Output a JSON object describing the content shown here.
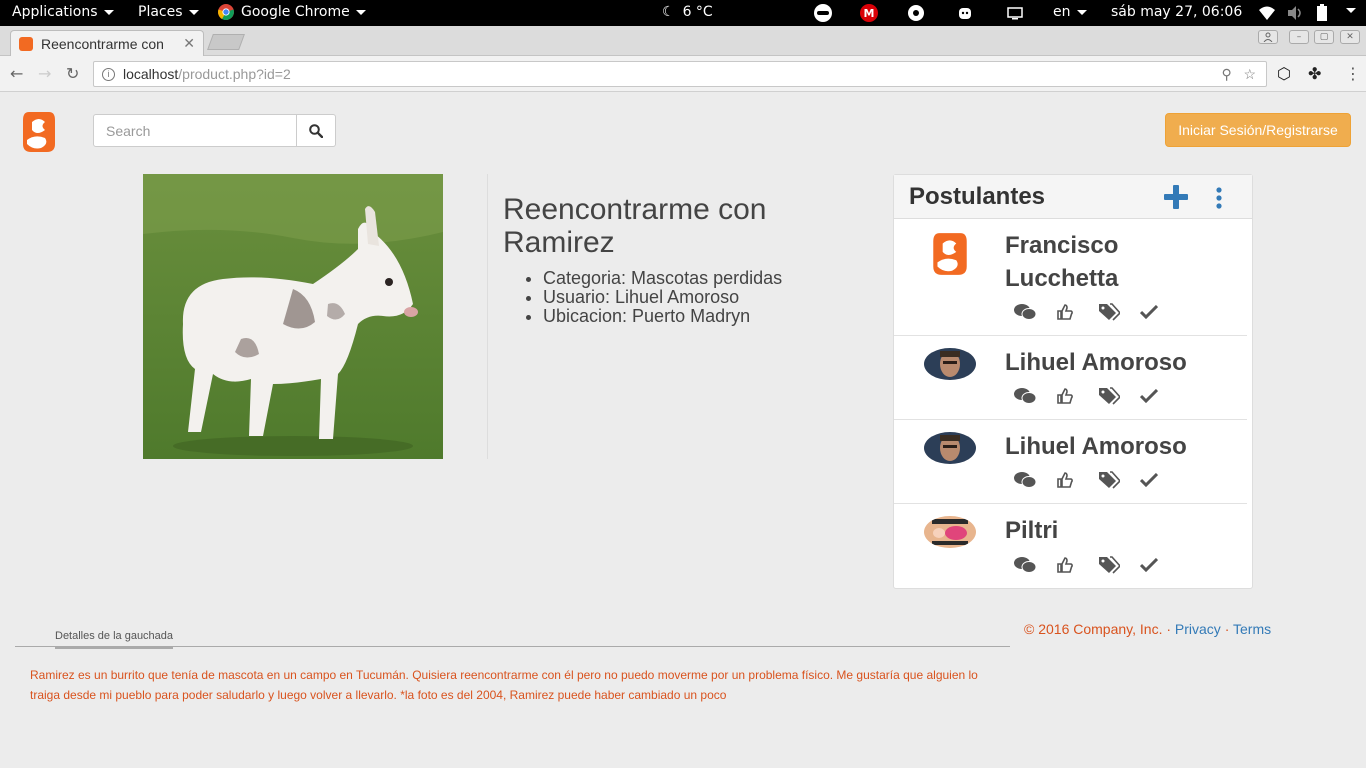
{
  "system_bar": {
    "applications": "Applications",
    "places": "Places",
    "active_app": "Google Chrome",
    "weather": "6 °C",
    "language": "en",
    "datetime": "sáb may 27, 06:06"
  },
  "browser": {
    "tab_title": "Reencontrarme con",
    "url_host": "localhost",
    "url_path": "/product.php?id=2"
  },
  "header": {
    "search_placeholder": "Search",
    "login_label": "Iniciar Sesión/Registrarse"
  },
  "product": {
    "title": "Reencontrarme con Ramirez",
    "details": [
      "Categoria: Mascotas perdidas",
      "Usuario: Lihuel Amoroso",
      "Ubicacion: Puerto Madryn"
    ]
  },
  "applicants": {
    "title": "Postulantes",
    "items": [
      {
        "name": "Francisco Lucchetta",
        "avatar": "logo"
      },
      {
        "name": "Lihuel Amoroso",
        "avatar": "photo"
      },
      {
        "name": "Lihuel Amoroso",
        "avatar": "photo"
      },
      {
        "name": "Piltri",
        "avatar": "meme"
      }
    ]
  },
  "footer": {
    "copyright": "© 2016 Company, Inc. · ",
    "privacy": "Privacy",
    "separator": " · ",
    "terms": "Terms"
  },
  "details_section": {
    "tab_label": "Detalles de la gauchada",
    "description": "Ramirez es un burrito que tenía de mascota en un campo en Tucumán. Quisiera reencontrarme con él pero no puedo moverme por un problema físico. Me gustaría que alguien lo traiga desde mi pueblo para poder saludarlo y luego volver a llevarlo. *la foto es del 2004, Ramirez puede haber cambiado un poco"
  },
  "colors": {
    "brand_orange": "#f26a22",
    "login_button": "#f0ad4e",
    "link_blue": "#337ab7",
    "accent_text": "#d9531e"
  }
}
